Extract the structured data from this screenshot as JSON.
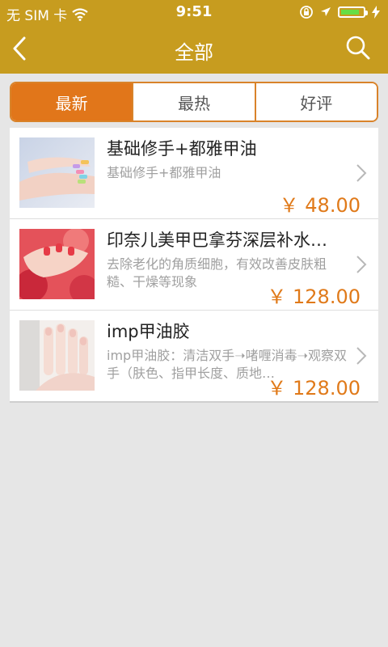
{
  "status_bar": {
    "carrier": "无 SIM 卡",
    "time": "9:51"
  },
  "nav": {
    "title": "全部",
    "back_icon": "chevron-left-icon",
    "search_icon": "search-icon"
  },
  "tabs": [
    {
      "label": "最新",
      "active": true
    },
    {
      "label": "最热",
      "active": false
    },
    {
      "label": "好评",
      "active": false
    }
  ],
  "items": [
    {
      "title": "基础修手+都雅甲油",
      "desc": "基础修手+都雅甲油",
      "price": "￥ 48.00"
    },
    {
      "title": "印奈儿美甲巴拿芬深层补水…",
      "desc": "去除老化的角质细胞，有效改善皮肤粗糙、干燥等现象",
      "price": "￥ 128.00"
    },
    {
      "title": "imp甲油胶",
      "desc": "imp甲油胶：清洁双手➝啫喱消毒➝观察双手（肤色、指甲长度、质地…",
      "price": "￥ 128.00"
    }
  ],
  "colors": {
    "header_bg": "#c79c1f",
    "accent": "#e1761a",
    "price": "#e07a1a"
  }
}
